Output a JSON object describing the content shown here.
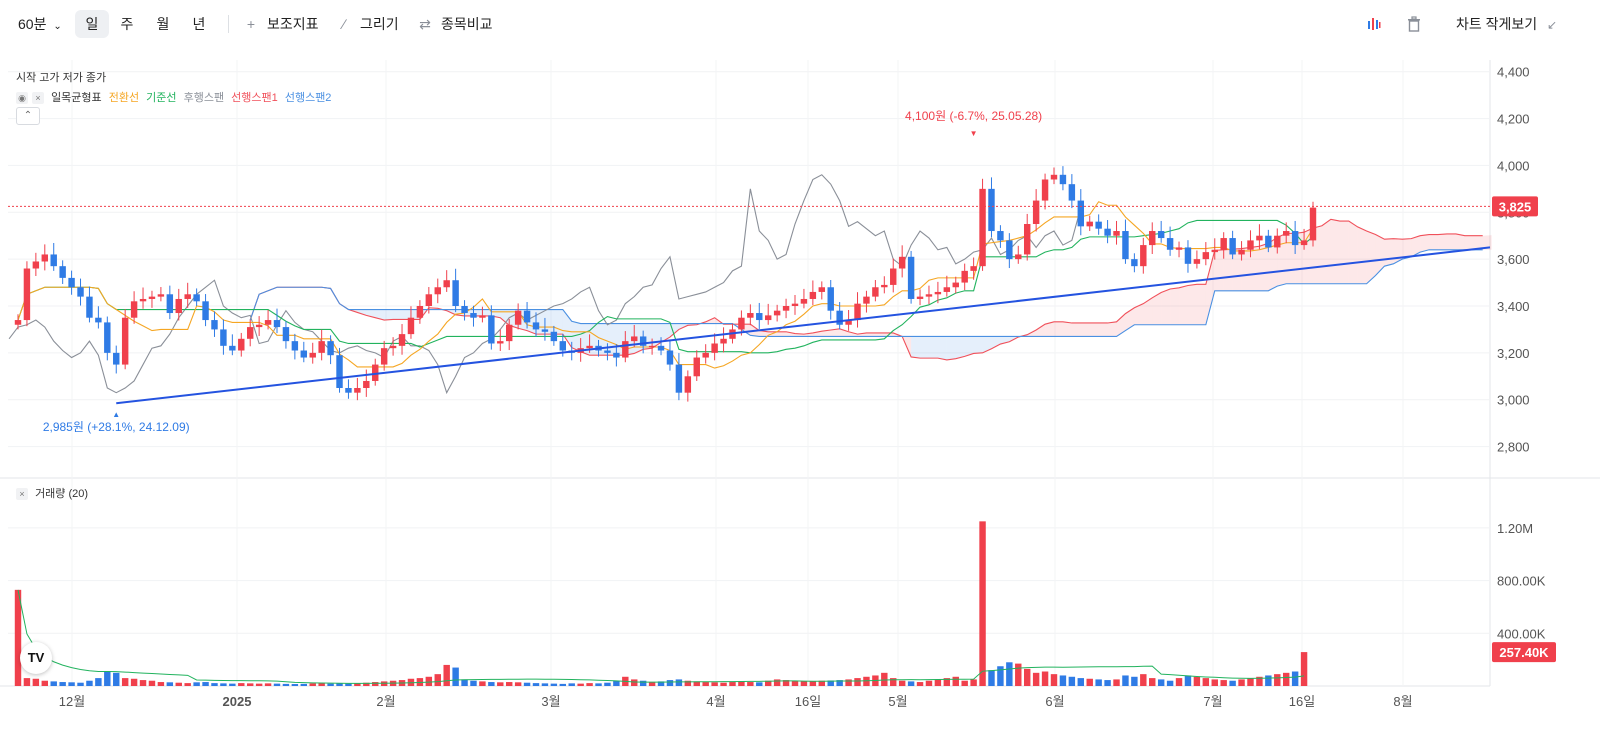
{
  "toolbar": {
    "interval": "60분",
    "periods": [
      "일",
      "주",
      "월",
      "년"
    ],
    "active_period": "일",
    "indicator_label": "보조지표",
    "draw_label": "그리기",
    "compare_label": "종목비교",
    "small_view_label": "차트 작게보기"
  },
  "legend": {
    "ohlc_label": "시작 고가 저가 종가",
    "ichimoku_name": "일목균형표",
    "ichimoku_lines": [
      {
        "name": "전환선",
        "color": "#f5a623"
      },
      {
        "name": "기준선",
        "color": "#22b35e"
      },
      {
        "name": "후행스팬",
        "color": "#8a8f98"
      },
      {
        "name": "선행스팬1",
        "color": "#f0505a"
      },
      {
        "name": "선행스팬2",
        "color": "#4a90e2"
      }
    ],
    "volume_label": "거래량 (20)"
  },
  "colors": {
    "up": "#f0404c",
    "down": "#2f7be5",
    "trend_line": "#2453e0",
    "current_price_line": "#f0404c"
  },
  "chart_data": {
    "type": "candlestick",
    "price_axis": {
      "ticks": [
        4400,
        4200,
        4000,
        3800,
        3600,
        3400,
        3200,
        3000,
        2800
      ],
      "tick_labels": [
        "4,400",
        "4,200",
        "4,000",
        "3,800",
        "3,600",
        "3,400",
        "3,200",
        "3,000",
        "2,800"
      ],
      "range": [
        2700,
        4450
      ]
    },
    "x_axis_labels": [
      "12월",
      "2025",
      "2월",
      "3월",
      "4월",
      "16일",
      "5월",
      "6월",
      "7월",
      "16일",
      "8월"
    ],
    "current_price": 3825,
    "current_price_label": "3,825",
    "high_annotation": "4,100원 (-6.7%, 25.05.28)",
    "high_price": 4100,
    "low_annotation": "2,985원 (+28.1%, 24.12.09)",
    "low_price": 2985,
    "closes": [
      3340,
      3560,
      3590,
      3620,
      3570,
      3520,
      3480,
      3440,
      3350,
      3330,
      3200,
      3150,
      3350,
      3420,
      3430,
      3440,
      3450,
      3370,
      3430,
      3450,
      3420,
      3340,
      3300,
      3230,
      3210,
      3260,
      3310,
      3320,
      3340,
      3310,
      3250,
      3210,
      3180,
      3200,
      3250,
      3190,
      3050,
      3030,
      3050,
      3080,
      3150,
      3220,
      3230,
      3280,
      3350,
      3400,
      3450,
      3480,
      3510,
      3400,
      3370,
      3350,
      3360,
      3240,
      3250,
      3320,
      3380,
      3330,
      3300,
      3290,
      3250,
      3210,
      3200,
      3220,
      3230,
      3210,
      3200,
      3180,
      3250,
      3270,
      3230,
      3230,
      3210,
      3150,
      3030,
      3100,
      3180,
      3200,
      3240,
      3260,
      3300,
      3350,
      3370,
      3340,
      3360,
      3380,
      3400,
      3410,
      3430,
      3460,
      3480,
      3380,
      3320,
      3340,
      3410,
      3440,
      3480,
      3490,
      3560,
      3610,
      3430,
      3440,
      3450,
      3460,
      3480,
      3500,
      3550,
      3570,
      3900,
      3720,
      3680,
      3600,
      3620,
      3750,
      3850,
      3940,
      3960,
      3920,
      3850,
      3740,
      3760,
      3730,
      3700,
      3720,
      3600,
      3570,
      3660,
      3720,
      3690,
      3640,
      3650,
      3580,
      3600,
      3630,
      3640,
      3690,
      3620,
      3640,
      3680,
      3700,
      3650,
      3700,
      3720,
      3660,
      3680,
      3820
    ],
    "volume_axis": {
      "ticks": [
        1200000,
        800000,
        400000
      ],
      "tick_labels": [
        "1.20M",
        "800.00K",
        "400.00K"
      ],
      "max": 1450000
    },
    "current_volume": 257400,
    "current_volume_label": "257.40K",
    "volumes": [
      730000,
      60000,
      55000,
      40000,
      35000,
      30000,
      28000,
      25000,
      40000,
      60000,
      110000,
      100000,
      60000,
      55000,
      45000,
      40000,
      30000,
      28000,
      25000,
      22000,
      28000,
      30000,
      22000,
      20000,
      18000,
      22000,
      20000,
      18000,
      20000,
      18000,
      16000,
      15000,
      16000,
      20000,
      22000,
      18000,
      20000,
      18000,
      22000,
      25000,
      30000,
      35000,
      40000,
      45000,
      55000,
      60000,
      70000,
      90000,
      160000,
      140000,
      50000,
      40000,
      35000,
      30000,
      28000,
      30000,
      28000,
      25000,
      22000,
      20000,
      18000,
      16000,
      20000,
      18000,
      22000,
      20000,
      25000,
      40000,
      70000,
      50000,
      40000,
      30000,
      35000,
      45000,
      50000,
      40000,
      35000,
      30000,
      28000,
      25000,
      30000,
      35000,
      30000,
      28000,
      40000,
      50000,
      45000,
      40000,
      35000,
      38000,
      40000,
      42000,
      45000,
      50000,
      60000,
      70000,
      80000,
      100000,
      60000,
      40000,
      35000,
      30000,
      40000,
      50000,
      60000,
      70000,
      40000,
      50000,
      1250000,
      120000,
      150000,
      180000,
      170000,
      130000,
      100000,
      110000,
      90000,
      80000,
      70000,
      60000,
      55000,
      50000,
      45000,
      50000,
      80000,
      70000,
      90000,
      60000,
      50000,
      40000,
      60000,
      80000,
      70000,
      60000,
      50000,
      45000,
      40000,
      50000,
      60000,
      70000,
      80000,
      90000,
      100000,
      110000,
      257400
    ]
  }
}
